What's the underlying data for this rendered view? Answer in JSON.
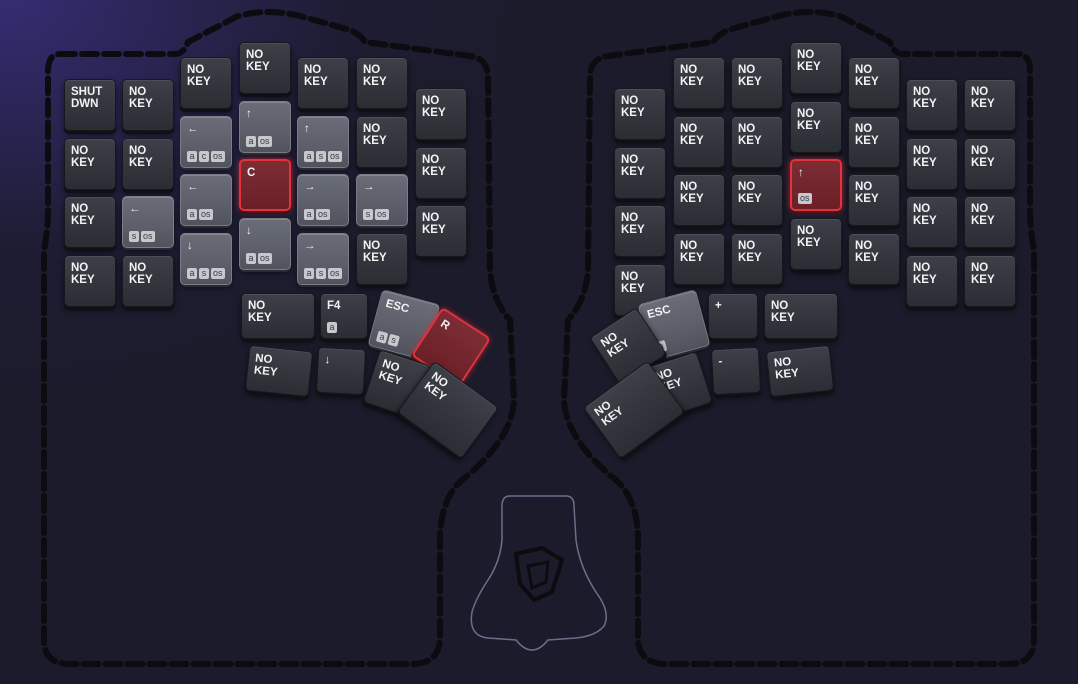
{
  "colors": {
    "background": "#1c1b2b",
    "glow": "#483aaa",
    "key": "#35373f",
    "key_active": "#5f626c",
    "key_red_border": "#e2323b",
    "key_red_fill": "#732530",
    "text": "#f2f2f2",
    "outline": "#0b0b10",
    "dock_line": "#6e6d8a"
  },
  "dock_icon": "moonlander-logo-icon",
  "left_hand": {
    "keys": [
      {
        "label": "SHUT\nDWN",
        "mods": [],
        "state": "normal"
      },
      {
        "label": "NO\nKEY",
        "mods": [],
        "state": "normal"
      },
      {
        "label": "NO\nKEY",
        "mods": [],
        "state": "normal"
      },
      {
        "label": "NO\nKEY",
        "mods": [],
        "state": "normal"
      },
      {
        "label": "NO\nKEY",
        "mods": [],
        "state": "normal"
      },
      {
        "label": "NO\nKEY",
        "mods": [],
        "state": "normal"
      },
      {
        "label": "NO\nKEY",
        "mods": [],
        "state": "normal"
      },
      {
        "label": "NO\nKEY",
        "mods": [],
        "state": "normal"
      },
      {
        "label": "NO\nKEY",
        "mods": [],
        "state": "normal"
      },
      {
        "label": "←",
        "mods": [
          "a",
          "c",
          "os"
        ],
        "state": "active"
      },
      {
        "label": "↑",
        "mods": [
          "a",
          "os"
        ],
        "state": "active"
      },
      {
        "label": "↑",
        "mods": [
          "a",
          "s",
          "os"
        ],
        "state": "active"
      },
      {
        "label": "NO\nKEY",
        "mods": [],
        "state": "normal"
      },
      {
        "label": "NO\nKEY",
        "mods": [],
        "state": "normal"
      },
      {
        "label": "NO\nKEY",
        "mods": [],
        "state": "normal"
      },
      {
        "label": "←",
        "mods": [
          "s",
          "os"
        ],
        "state": "active"
      },
      {
        "label": "←",
        "mods": [
          "a",
          "os"
        ],
        "state": "active"
      },
      {
        "label": "C",
        "mods": [],
        "state": "red"
      },
      {
        "label": "→",
        "mods": [
          "a",
          "os"
        ],
        "state": "active"
      },
      {
        "label": "→",
        "mods": [
          "s",
          "os"
        ],
        "state": "active"
      },
      {
        "label": "NO\nKEY",
        "mods": [],
        "state": "normal"
      },
      {
        "label": "NO\nKEY",
        "mods": [],
        "state": "normal"
      },
      {
        "label": "NO\nKEY",
        "mods": [],
        "state": "normal"
      },
      {
        "label": "↓",
        "mods": [
          "a",
          "s",
          "os"
        ],
        "state": "active"
      },
      {
        "label": "↓",
        "mods": [
          "a",
          "os"
        ],
        "state": "active"
      },
      {
        "label": "→",
        "mods": [
          "a",
          "s",
          "os"
        ],
        "state": "active"
      },
      {
        "label": "NO\nKEY",
        "mods": [],
        "state": "normal"
      }
    ],
    "bottom_row": [
      {
        "label": "NO\nKEY",
        "mods": [],
        "state": "normal"
      },
      {
        "label": "F4",
        "mods": [
          "a"
        ],
        "state": "normal"
      }
    ],
    "lower_row": [
      {
        "label": "NO\nKEY",
        "mods": [],
        "state": "normal"
      },
      {
        "label": "↓",
        "mods": [],
        "state": "normal"
      }
    ],
    "thumb": [
      {
        "label": "ESC",
        "mods": [
          "a",
          "s"
        ],
        "state": "active"
      },
      {
        "label": "R",
        "mods": [],
        "state": "red"
      },
      {
        "label": "NO\nKEY",
        "mods": [],
        "state": "normal"
      },
      {
        "label": "NO\nKEY",
        "mods": [],
        "state": "normal"
      }
    ]
  },
  "right_hand": {
    "keys": [
      {
        "label": "NO\nKEY",
        "mods": [],
        "state": "normal"
      },
      {
        "label": "NO\nKEY",
        "mods": [],
        "state": "normal"
      },
      {
        "label": "NO\nKEY",
        "mods": [],
        "state": "normal"
      },
      {
        "label": "NO\nKEY",
        "mods": [],
        "state": "normal"
      },
      {
        "label": "NO\nKEY",
        "mods": [],
        "state": "normal"
      },
      {
        "label": "NO\nKEY",
        "mods": [],
        "state": "normal"
      },
      {
        "label": "NO\nKEY",
        "mods": [],
        "state": "normal"
      },
      {
        "label": "NO\nKEY",
        "mods": [],
        "state": "normal"
      },
      {
        "label": "NO\nKEY",
        "mods": [],
        "state": "normal"
      },
      {
        "label": "NO\nKEY",
        "mods": [],
        "state": "normal"
      },
      {
        "label": "NO\nKEY",
        "mods": [],
        "state": "normal"
      },
      {
        "label": "NO\nKEY",
        "mods": [],
        "state": "normal"
      },
      {
        "label": "NO\nKEY",
        "mods": [],
        "state": "normal"
      },
      {
        "label": "NO\nKEY",
        "mods": [],
        "state": "normal"
      },
      {
        "label": "NO\nKEY",
        "mods": [],
        "state": "normal"
      },
      {
        "label": "NO\nKEY",
        "mods": [],
        "state": "normal"
      },
      {
        "label": "NO\nKEY",
        "mods": [],
        "state": "normal"
      },
      {
        "label": "↑",
        "mods": [
          "os"
        ],
        "state": "red"
      },
      {
        "label": "NO\nKEY",
        "mods": [],
        "state": "normal"
      },
      {
        "label": "NO\nKEY",
        "mods": [],
        "state": "normal"
      },
      {
        "label": "NO\nKEY",
        "mods": [],
        "state": "normal"
      },
      {
        "label": "NO\nKEY",
        "mods": [],
        "state": "normal"
      },
      {
        "label": "NO\nKEY",
        "mods": [],
        "state": "normal"
      },
      {
        "label": "NO\nKEY",
        "mods": [],
        "state": "normal"
      },
      {
        "label": "NO\nKEY",
        "mods": [],
        "state": "normal"
      },
      {
        "label": "NO\nKEY",
        "mods": [],
        "state": "normal"
      },
      {
        "label": "NO\nKEY",
        "mods": [],
        "state": "normal"
      },
      {
        "label": "NO\nKEY",
        "mods": [],
        "state": "normal"
      }
    ],
    "bottom_row": [
      {
        "label": "+",
        "mods": [],
        "state": "normal"
      },
      {
        "label": "NO\nKEY",
        "mods": [],
        "state": "normal"
      }
    ],
    "lower_row": [
      {
        "label": "-",
        "mods": [],
        "state": "normal"
      },
      {
        "label": "NO\nKEY",
        "mods": [],
        "state": "normal"
      }
    ],
    "thumb": [
      {
        "label": "ESC",
        "mods": [
          "a"
        ],
        "state": "active"
      },
      {
        "label": "NO\nKEY",
        "mods": [],
        "state": "normal"
      },
      {
        "label": "NO\nKEY",
        "mods": [],
        "state": "normal"
      },
      {
        "label": "NO\nKEY",
        "mods": [],
        "state": "normal"
      }
    ]
  }
}
